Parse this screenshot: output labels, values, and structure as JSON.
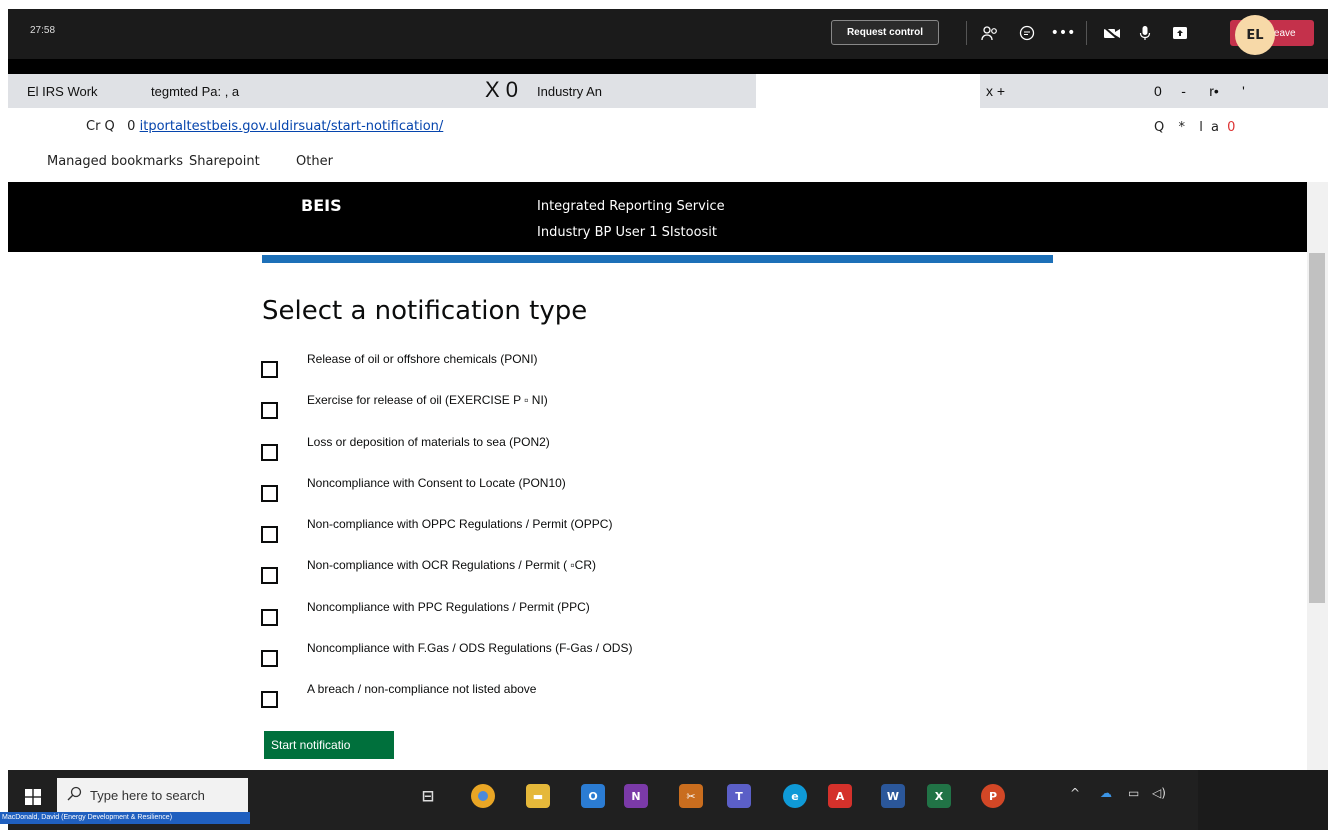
{
  "teams": {
    "timer": "27:58",
    "request_control": "Request control",
    "leave": "Leave"
  },
  "browser": {
    "tabs": [
      {
        "label": "El IRS Work"
      },
      {
        "label": "tegmted Pa: ,     a"
      },
      {
        "label": "Industry An"
      }
    ],
    "tab_close": "x",
    "tab_big": "X 0",
    "tab_new": "x   +",
    "window_ctl": "0     -      r•      '",
    "address_prefix": "Cr Q   0",
    "url": "itportaltestbeis.gov.uldirsuat/start-notification/",
    "address_icons": "Q  *  l a",
    "address_icon_red": "0",
    "bookmarks": [
      "Managed bookmarks",
      "Sharepoint",
      "Other"
    ]
  },
  "header": {
    "brand": "BEIS",
    "service": "Integrated Reporting Service",
    "user": "Industry BP User 1 SIstoosit"
  },
  "main": {
    "heading": "Select a notification type",
    "options": [
      "Release of oil or offshore chemicals (PONI)",
      "Exercise for release of oil (EXERCISE P  ▫ NI)",
      "Loss or deposition of materials to sea (PON2)",
      "Noncompliance with Consent to Locate (PON10)",
      "Non-compliance with OPPC Regulations / Permit (OPPC)",
      "Non-compliance with OCR Regulations / Permit (   ▫CR)",
      "Noncompliance with PPC Regulations / Permit (PPC)",
      "Noncompliance with F.Gas / ODS Regulations (F-Gas / ODS)",
      "A breach / non-compliance not listed above"
    ],
    "start_button": "Start notificatio"
  },
  "taskbar": {
    "search_placeholder": "Type here to search",
    "avatar_initials": "EL",
    "user_label": "MacDonald, David (Energy Development & Resilience)"
  }
}
